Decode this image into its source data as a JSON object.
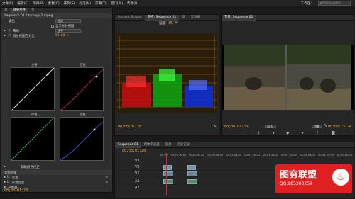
{
  "menu": [
    "文件(F)",
    "编辑(E)",
    "项目(P)",
    "素材(C)",
    "序列(S)",
    "标记(M)",
    "字幕(T)",
    "窗口(W)",
    "帮助(H)"
  ],
  "workspace": {
    "label": "工作区:",
    "value": "Effects Color"
  },
  "left_panel": {
    "tabs": [
      "源",
      "效果控件",
      "音"
    ],
    "sequence": "Sequence 01 * turkeys-2.mpeg",
    "output_label": "输出",
    "output_value": "合成",
    "show_split": "显示拆分视图",
    "layout_label": "布局",
    "layout_value": "水平",
    "split_label": "拆分视图百分比",
    "split_value": "50.00 %",
    "curves": {
      "master": "主要",
      "red": "红色",
      "green": "绿色",
      "blue": "蓝色"
    },
    "secondary": "辅助颜色校正",
    "audio_section": "音频效果",
    "audio_items": [
      "音量",
      "声道音量",
      "声像器"
    ],
    "timecode": "00;00;01;28"
  },
  "scope_panel": {
    "tabs": [
      "Lumetri Scopes",
      "参考: Sequence 01",
      "源",
      "元数据"
    ],
    "brightness_label": "强度:",
    "brightness_value": "35",
    "percent": "%",
    "timecode": "00;00;01;28",
    "fit": "适合"
  },
  "program_panel": {
    "tab": "节目: Sequence 01",
    "timecode": "00;00;01;28",
    "fit": "适合",
    "quality": "完整",
    "duration": "00;00;23;24"
  },
  "timeline": {
    "tab": "Sequence 01",
    "tabs2": [
      "媒体浏览器",
      "信息",
      "历史记录"
    ],
    "timecode": "00;00;01;28",
    "ruler": [
      "00;00",
      "00;00;16;00",
      "00;00;32;00",
      "00;00;48;00",
      "00;01;04;02",
      "00;01;20;02",
      "00;01;36;02",
      "00;01;52;02",
      "00;02;08;04",
      "00;02;24;04",
      "00;02;40;04"
    ],
    "tracks": [
      "V3",
      "V2",
      "V1",
      "A1",
      "A2"
    ]
  },
  "watermark": {
    "title": "图穷联盟",
    "qq": "QQ:985303259"
  },
  "colors": {
    "accent": "#e8a33a",
    "red": "#e02020"
  }
}
